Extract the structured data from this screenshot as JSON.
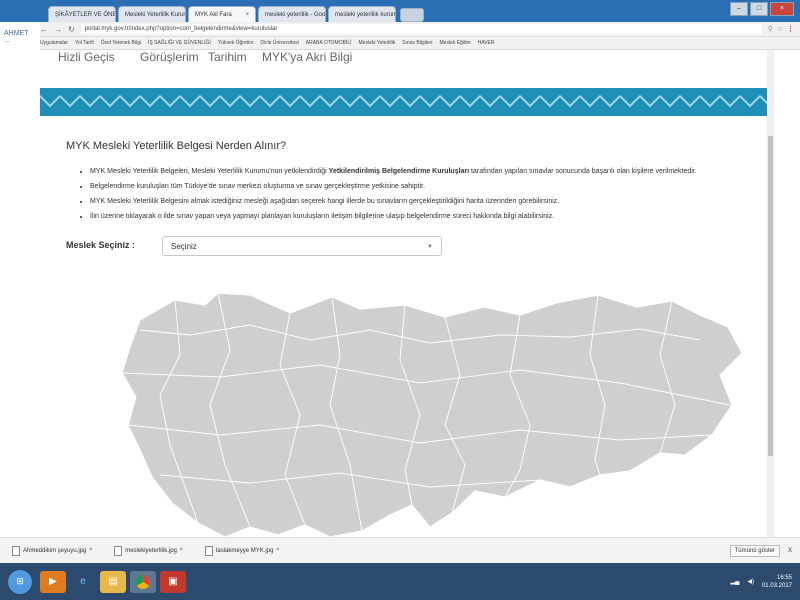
{
  "browser": {
    "tabs": [
      {
        "label": "ŞİKÂYETLER VE ÖNERİLER",
        "active": false
      },
      {
        "label": "Mesleki Yeterlilik Kurumu",
        "active": false
      },
      {
        "label": "MYK Akl Fara",
        "active": true
      },
      {
        "label": "mesleki yeterlilik - Google",
        "active": false
      },
      {
        "label": "mesleki yeterlilik kurumu",
        "active": false
      }
    ],
    "window_controls": [
      "–",
      "□",
      "×"
    ],
    "url": "portal.myk.gov.tr/index.php?option=com_belgelendirme&view=kuruluslar",
    "bookmarks": [
      "Uygulamalar",
      "Yol Tarifi",
      "Özel Yetenek Bilgi",
      "İŞ SAĞLIĞI VE GÜVENLİĞİ",
      "Yüksek Öğretim",
      "Dicle Üniversitesi",
      "ARABA OTOMOBİLİ",
      "Mesleki Yeterlilik",
      "Sınav Bilgileri",
      "Meslek Eğitim",
      "HAVER"
    ]
  },
  "site": {
    "left_links": "AHMET ...",
    "menu_items": [
      "Hizli Geçis",
      "Görüşlerim",
      "Tarihim",
      "MYK'ya Akri Bilgi"
    ],
    "title": "MYK Mesleki Yeterlilik Belgesi Nerden Alınır?",
    "bullets": [
      {
        "pre": "MYK Mesleki Yeterlilik Belgeleri, Mesleki Yeterlilik Kurumu'nun yetkilendirdiği ",
        "bold": "Yetkilendirilmiş Belgelendirme Kuruluşları",
        "post": " tarafından yapılan sınavlar sonucunda başarılı olan kişilere verilmektedir."
      },
      {
        "pre": "Belgelendirme kuruluşları tüm Türkiye'de sınav merkezi oluşturma ve sınav gerçekleştirme yetkisine sahiptir.",
        "bold": "",
        "post": ""
      },
      {
        "pre": "MYK Mesleki Yeterlilik Belgesini almak istediğiniz mesleği aşağıdan seçerek hangi illerde bu sınavların gerçekleştirildiğini harita üzerinden görebilirsiniz.",
        "bold": "",
        "post": ""
      },
      {
        "pre": "İlin üzerine tıklayarak o ilde sınav yapan veya yapmayı planlayan kuruluşların iletişim bilgilerine ulaşıp belgelendirme süreci hakkında bilgi alabilirsiniz.",
        "bold": "",
        "post": ""
      }
    ],
    "select_label": "Meslek Seçiniz :",
    "select_value": "Seçiniz"
  },
  "downloads": {
    "items": [
      "Ahmeddikim şeyuyu.jpg",
      "meslekiyeterlilik.jpg",
      "taslakmeyye MYK.jpg"
    ],
    "show_all": "Tümünü göster",
    "close": "X"
  },
  "taskbar": {
    "time": "16:55",
    "date": "01.03.2017"
  },
  "colors": {
    "window_frame": "#2a6fb3",
    "deco_band": "#1e90b8",
    "map_fill": "#cfcfcf",
    "taskbar": "#2b4a6e"
  }
}
